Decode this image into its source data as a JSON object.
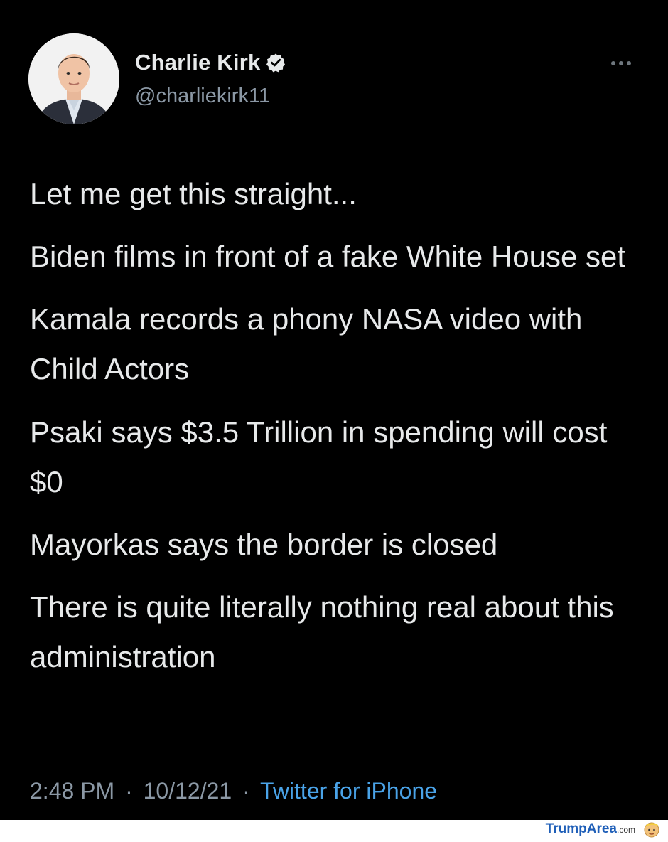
{
  "author": {
    "display_name": "Charlie Kirk",
    "handle": "@charliekirk11",
    "verified": true
  },
  "tweet": {
    "paragraphs": [
      "Let me get this straight...",
      "Biden films in front of a fake White House set",
      "Kamala records a phony NASA video with Child Actors",
      "Psaki says $3.5 Trillion in spending will cost $0",
      "Mayorkas says the border is closed",
      "There is quite literally nothing real about this administration"
    ],
    "time": "2:48 PM",
    "date": "10/12/21",
    "separator": "·",
    "source": "Twitter for iPhone"
  },
  "watermark": {
    "brand": "TrumpArea",
    "suffix": ".com"
  },
  "colors": {
    "background": "#000000",
    "text": "#e7e9ea",
    "secondary": "#8b98a5",
    "link": "#4aa3e8"
  }
}
